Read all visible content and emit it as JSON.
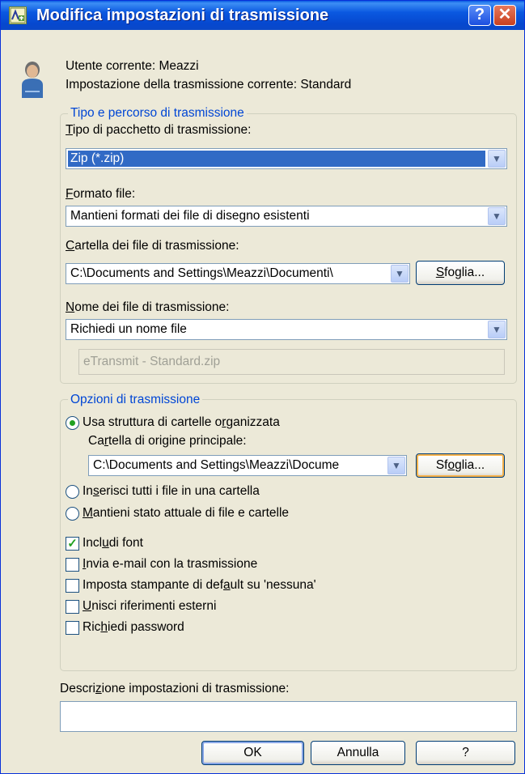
{
  "window": {
    "title": "Modifica impostazioni di trasmissione",
    "help_label": "?",
    "close_label": "✕"
  },
  "icons": {
    "app": "autocad-app-icon",
    "user": "user-icon"
  },
  "info": {
    "current_user": "Utente corrente: Meazzi",
    "current_setting": "Impostazione della trasmissione corrente: Standard"
  },
  "group1": {
    "legend": "Tipo e percorso di trasmissione",
    "package_type": {
      "label_accel": "T",
      "label_rest": "ipo di pacchetto di trasmissione:",
      "value": "Zip (*.zip)"
    },
    "file_format": {
      "label_accel": "F",
      "label_rest": "ormato file:",
      "value": "Mantieni formati dei file di disegno esistenti"
    },
    "folder": {
      "label_accel": "C",
      "label_rest": "artella dei file di trasmissione:",
      "value": "C:\\Documents and Settings\\Meazzi\\Documenti\\",
      "browse_accel": "S",
      "browse_rest": "foglia..."
    },
    "filename": {
      "label_accel": "N",
      "label_rest": "ome dei file di trasmissione:",
      "value": "Richiedi un nome file",
      "disabled_value": "eTransmit - Standard.zip"
    }
  },
  "group2": {
    "legend": "Opzioni di trasmissione",
    "radios": [
      {
        "pre": "Usa struttura di cartelle o",
        "accel": "r",
        "post": "ganizzata",
        "selected": true
      },
      {
        "pre": "In",
        "accel": "s",
        "post": "erisci tutti i file in una cartella",
        "selected": false
      },
      {
        "pre": "",
        "accel": "M",
        "post": "antieni stato attuale di file e cartelle",
        "selected": false
      }
    ],
    "root_folder": {
      "pre": "Ca",
      "accel": "r",
      "post": "tella di origine principale:",
      "value": "C:\\Documents and Settings\\Meazzi\\Docume",
      "browse_pre": "Sf",
      "browse_accel": "o",
      "browse_post": "glia..."
    },
    "checks": [
      {
        "pre": "Incl",
        "accel": "u",
        "post": "di font",
        "checked": true
      },
      {
        "pre": "",
        "accel": "I",
        "post": "nvia e-mail con la trasmissione",
        "checked": false
      },
      {
        "pre": "Imposta stampante di def",
        "accel": "a",
        "post": "ult su 'nessuna'",
        "checked": false
      },
      {
        "pre": "",
        "accel": "U",
        "post": "nisci riferimenti esterni",
        "checked": false
      },
      {
        "pre": "Ric",
        "accel": "h",
        "post": "iedi password",
        "checked": false
      }
    ]
  },
  "description": {
    "pre": "Descri",
    "accel": "z",
    "post": "ione impostazioni di trasmissione:",
    "value": ""
  },
  "buttons": {
    "ok": "OK",
    "cancel": "Annulla",
    "help": "?"
  },
  "colors": {
    "titlebar": "#0a58e0",
    "legend": "#0046d5",
    "selection": "#316ac5",
    "check": "#21a121"
  }
}
